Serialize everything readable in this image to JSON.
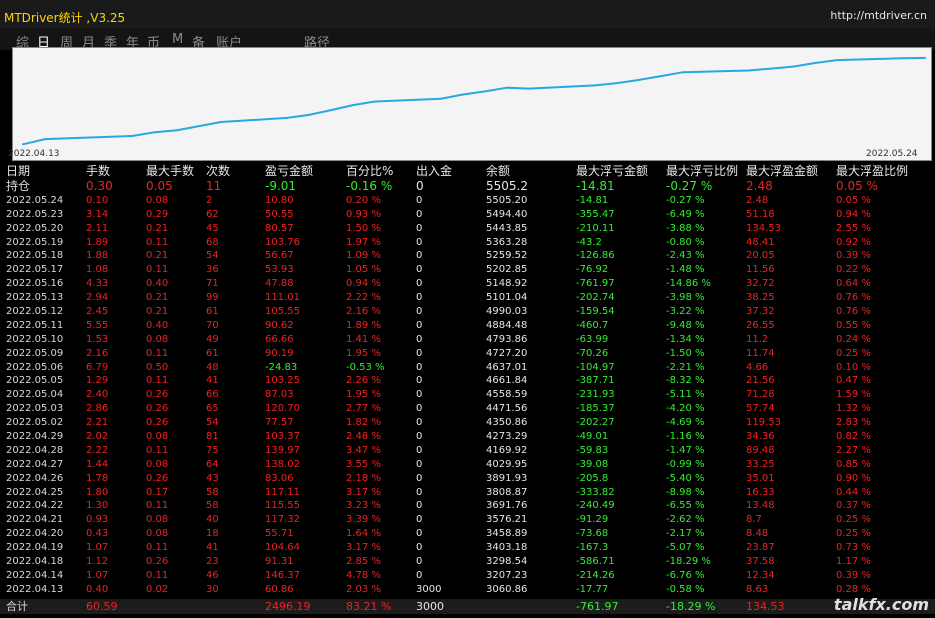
{
  "app": {
    "title": "MTDriver统计 ,V3.25",
    "url": "http://mtdriver.cn"
  },
  "tabs": [
    {
      "label": "综",
      "active": false
    },
    {
      "label": "日",
      "active": true
    },
    {
      "label": "周",
      "active": false
    },
    {
      "label": "月",
      "active": false
    },
    {
      "label": "季",
      "active": false
    },
    {
      "label": "年",
      "active": false
    },
    {
      "label": "币",
      "active": false
    },
    {
      "label": "M",
      "active": false
    },
    {
      "label": "备",
      "active": false
    },
    {
      "label": "账户",
      "active": false
    },
    {
      "label": "路径",
      "active": false
    }
  ],
  "chart": {
    "start_date": "2022.04.13",
    "end_date": "2022.05.24",
    "line_color": "#29a8e0"
  },
  "chart_data": {
    "type": "line",
    "x": [
      "2022.04.13",
      "2022.04.14",
      "2022.04.18",
      "2022.04.19",
      "2022.04.20",
      "2022.04.21",
      "2022.04.22",
      "2022.04.25",
      "2022.04.26",
      "2022.04.27",
      "2022.04.28",
      "2022.04.29",
      "2022.05.02",
      "2022.05.03",
      "2022.05.04",
      "2022.05.05",
      "2022.05.06",
      "2022.05.09",
      "2022.05.10",
      "2022.05.11",
      "2022.05.12",
      "2022.05.13",
      "2022.05.16",
      "2022.05.17",
      "2022.05.18",
      "2022.05.19",
      "2022.05.20",
      "2022.05.23",
      "2022.05.24"
    ],
    "values": [
      3060.86,
      3207.23,
      3298.54,
      3403.18,
      3458.89,
      3576.21,
      3691.76,
      3808.87,
      3891.93,
      4029.95,
      4169.92,
      4273.29,
      4350.86,
      4471.56,
      4558.59,
      4661.84,
      4637.01,
      4727.2,
      4793.86,
      4884.48,
      4990.03,
      5101.04,
      5148.92,
      5202.85,
      5259.52,
      5363.28,
      5443.85,
      5494.4,
      5505.2
    ]
  },
  "table": {
    "headers": [
      "日期",
      "手数",
      "最大手数",
      "次数",
      "盈亏金额",
      "百分比%",
      "出入金",
      "余额",
      "最大浮亏金额",
      "最大浮亏比例",
      "最大浮盈金额",
      "最大浮盈比例"
    ],
    "holding": [
      "持仓",
      "0.30",
      "0.05",
      "11",
      "-9.01",
      "-0.16 %",
      "0",
      "5505.2",
      "-14.81",
      "-0.27 %",
      "2.48",
      "0.05 %"
    ],
    "rows": [
      [
        "2022.05.24",
        "0.10",
        "0.08",
        "2",
        "10.80",
        "0.20 %",
        "0",
        "5505.20",
        "-14.81",
        "-0.27 %",
        "2.48",
        "0.05 %"
      ],
      [
        "2022.05.23",
        "3.14",
        "0.29",
        "62",
        "50.55",
        "0.93 %",
        "0",
        "5494.40",
        "-355.47",
        "-6.49 %",
        "51.18",
        "0.94 %"
      ],
      [
        "2022.05.20",
        "2.11",
        "0.21",
        "45",
        "80.57",
        "1.50 %",
        "0",
        "5443.85",
        "-210.11",
        "-3.88 %",
        "134.53",
        "2.55 %"
      ],
      [
        "2022.05.19",
        "1.89",
        "0.11",
        "68",
        "103.76",
        "1.97 %",
        "0",
        "5363.28",
        "-43.2",
        "-0.80 %",
        "48.41",
        "0.92 %"
      ],
      [
        "2022.05.18",
        "1.88",
        "0.21",
        "54",
        "56.67",
        "1.09 %",
        "0",
        "5259.52",
        "-126.86",
        "-2.43 %",
        "20.05",
        "0.39 %"
      ],
      [
        "2022.05.17",
        "1.08",
        "0.11",
        "36",
        "53.93",
        "1.05 %",
        "0",
        "5202.85",
        "-76.92",
        "-1.48 %",
        "11.56",
        "0.22 %"
      ],
      [
        "2022.05.16",
        "4.33",
        "0.40",
        "71",
        "47.88",
        "0.94 %",
        "0",
        "5148.92",
        "-761.97",
        "-14.86 %",
        "32.72",
        "0.64 %"
      ],
      [
        "2022.05.13",
        "2.94",
        "0.21",
        "99",
        "111.01",
        "2.22 %",
        "0",
        "5101.04",
        "-202.74",
        "-3.98 %",
        "38.25",
        "0.76 %"
      ],
      [
        "2022.05.12",
        "2.45",
        "0.21",
        "61",
        "105.55",
        "2.16 %",
        "0",
        "4990.03",
        "-159.54",
        "-3.22 %",
        "37.32",
        "0.76 %"
      ],
      [
        "2022.05.11",
        "5.55",
        "0.40",
        "70",
        "90.62",
        "1.89 %",
        "0",
        "4884.48",
        "-460.7",
        "-9.48 %",
        "26.55",
        "0.55 %"
      ],
      [
        "2022.05.10",
        "1.53",
        "0.08",
        "49",
        "66.66",
        "1.41 %",
        "0",
        "4793.86",
        "-63.99",
        "-1.34 %",
        "11.2",
        "0.24 %"
      ],
      [
        "2022.05.09",
        "2.16",
        "0.11",
        "61",
        "90.19",
        "1.95 %",
        "0",
        "4727.20",
        "-70.26",
        "-1.50 %",
        "11.74",
        "0.25 %"
      ],
      [
        "2022.05.06",
        "6.79",
        "0.50",
        "48",
        "-24.83",
        "-0.53 %",
        "0",
        "4637.01",
        "-104.97",
        "-2.21 %",
        "4.66",
        "0.10 %"
      ],
      [
        "2022.05.05",
        "1.29",
        "0.11",
        "41",
        "103.25",
        "2.26 %",
        "0",
        "4661.84",
        "-387.71",
        "-8.32 %",
        "21.56",
        "0.47 %"
      ],
      [
        "2022.05.04",
        "2.40",
        "0.26",
        "66",
        "87.03",
        "1.95 %",
        "0",
        "4558.59",
        "-231.93",
        "-5.11 %",
        "71.28",
        "1.59 %"
      ],
      [
        "2022.05.03",
        "2.86",
        "0.26",
        "65",
        "120.70",
        "2.77 %",
        "0",
        "4471.56",
        "-185.37",
        "-4.20 %",
        "57.74",
        "1.32 %"
      ],
      [
        "2022.05.02",
        "2.21",
        "0.26",
        "54",
        "77.57",
        "1.82 %",
        "0",
        "4350.86",
        "-202.27",
        "-4.69 %",
        "119.53",
        "2.83 %"
      ],
      [
        "2022.04.29",
        "2.02",
        "0.08",
        "81",
        "103.37",
        "2.48 %",
        "0",
        "4273.29",
        "-49.01",
        "-1.16 %",
        "34.36",
        "0.82 %"
      ],
      [
        "2022.04.28",
        "2.22",
        "0.11",
        "75",
        "139.97",
        "3.47 %",
        "0",
        "4169.92",
        "-59.83",
        "-1.47 %",
        "89.48",
        "2.27 %"
      ],
      [
        "2022.04.27",
        "1.44",
        "0.08",
        "64",
        "138.02",
        "3.55 %",
        "0",
        "4029.95",
        "-39.08",
        "-0.99 %",
        "33.25",
        "0.85 %"
      ],
      [
        "2022.04.26",
        "1.78",
        "0.26",
        "43",
        "83.06",
        "2.18 %",
        "0",
        "3891.93",
        "-205.8",
        "-5.40 %",
        "35.01",
        "0.90 %"
      ],
      [
        "2022.04.25",
        "1.80",
        "0.17",
        "58",
        "117.11",
        "3.17 %",
        "0",
        "3808.87",
        "-333.82",
        "-8.98 %",
        "16.33",
        "0.44 %"
      ],
      [
        "2022.04.22",
        "1.30",
        "0.11",
        "58",
        "115.55",
        "3.23 %",
        "0",
        "3691.76",
        "-240.49",
        "-6.55 %",
        "13.48",
        "0.37 %"
      ],
      [
        "2022.04.21",
        "0.93",
        "0.08",
        "40",
        "117.32",
        "3.39 %",
        "0",
        "3576.21",
        "-91.29",
        "-2.62 %",
        "8.7",
        "0.25 %"
      ],
      [
        "2022.04.20",
        "0.43",
        "0.08",
        "18",
        "55.71",
        "1.64 %",
        "0",
        "3458.89",
        "-73.68",
        "-2.17 %",
        "8.48",
        "0.25 %"
      ],
      [
        "2022.04.19",
        "1.07",
        "0.11",
        "41",
        "104.64",
        "3.17 %",
        "0",
        "3403.18",
        "-167.3",
        "-5.07 %",
        "23.87",
        "0.73 %"
      ],
      [
        "2022.04.18",
        "1.12",
        "0.26",
        "23",
        "91.31",
        "2.85 %",
        "0",
        "3298.54",
        "-586.71",
        "-18.29 %",
        "37.58",
        "1.17 %"
      ],
      [
        "2022.04.14",
        "1.07",
        "0.11",
        "46",
        "146.37",
        "4.78 %",
        "0",
        "3207.23",
        "-214.26",
        "-6.76 %",
        "12.34",
        "0.39 %"
      ],
      [
        "2022.04.13",
        "0.40",
        "0.02",
        "30",
        "60.86",
        "2.03 %",
        "3000",
        "3060.86",
        "-17.77",
        "-0.58 %",
        "8.63",
        "0.28 %"
      ]
    ],
    "total": [
      "合计",
      "60.59",
      "",
      "",
      "2496.19",
      "83.21 %",
      "3000",
      "",
      "-761.97",
      "-18.29 %",
      "134.53",
      ""
    ]
  },
  "watermark": "talkfx.com"
}
